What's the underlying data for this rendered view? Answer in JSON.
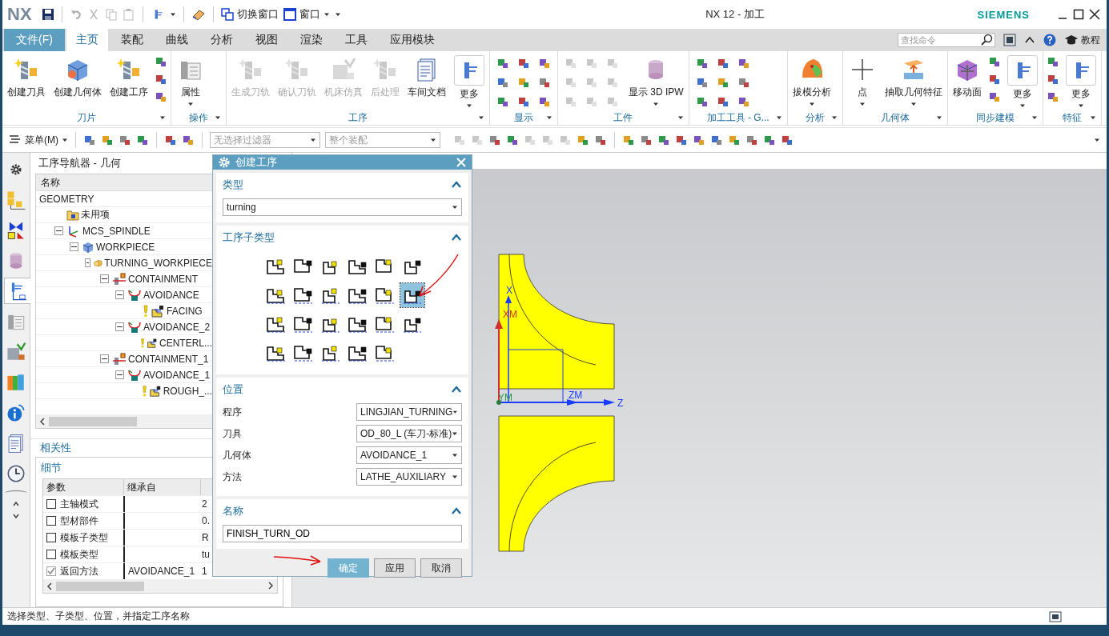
{
  "window": {
    "logo": "NX",
    "title": "NX 12 - 加工",
    "brand": "SIEMENS"
  },
  "quick_access": {
    "switch_window": "切换窗口",
    "window_menu": "窗口"
  },
  "file_tab": "文件(F)",
  "tabs": [
    {
      "label": "主页",
      "selected": true
    },
    {
      "label": "装配",
      "selected": false
    },
    {
      "label": "曲线",
      "selected": false
    },
    {
      "label": "分析",
      "selected": false
    },
    {
      "label": "视图",
      "selected": false
    },
    {
      "label": "渲染",
      "selected": false
    },
    {
      "label": "工具",
      "selected": false
    },
    {
      "label": "应用模块",
      "selected": false
    }
  ],
  "search": {
    "placeholder": "查找命令"
  },
  "help_label": "教程",
  "ribbon_groups": [
    {
      "label": "刀片",
      "items": [
        {
          "kind": "drill",
          "label": "创建刀具",
          "disabled": false,
          "dropdown": false
        },
        {
          "kind": "cube",
          "label": "创建几何体",
          "disabled": false,
          "dropdown": false
        },
        {
          "kind": "drill",
          "label": "创建工序",
          "disabled": false,
          "dropdown": false
        },
        {
          "kind": "small_column"
        }
      ]
    },
    {
      "label": "操作",
      "items": [
        {
          "kind": "table",
          "label": "属性",
          "disabled": false,
          "dropdown": true
        }
      ]
    },
    {
      "label": "工序",
      "items": [
        {
          "kind": "drill",
          "label": "生成刀轨",
          "disabled": true,
          "dropdown": false
        },
        {
          "kind": "drill",
          "label": "确认刀轨",
          "disabled": true,
          "dropdown": false
        },
        {
          "kind": "machine",
          "label": "机床仿真",
          "disabled": true,
          "dropdown": false
        },
        {
          "kind": "drill",
          "label": "后处理",
          "disabled": true,
          "dropdown": false
        },
        {
          "kind": "doc",
          "label": "车间文档",
          "disabled": false,
          "dropdown": false
        },
        {
          "kind": "more",
          "label": "更多",
          "disabled": false,
          "dropdown": true
        }
      ]
    },
    {
      "label": "显示",
      "items": [
        {
          "kind": "small_grid"
        }
      ]
    },
    {
      "label": "工件",
      "items": [
        {
          "kind": "small_grid"
        },
        {
          "kind": "cylinder",
          "label": "显示 3D IPW",
          "disabled": false,
          "dropdown": true
        }
      ]
    },
    {
      "label": "加工工具 - G...",
      "items": [
        {
          "kind": "small_grid"
        }
      ]
    },
    {
      "label": "分析",
      "items": [
        {
          "kind": "surface",
          "label": "拔模分析",
          "disabled": false,
          "dropdown": true
        }
      ]
    },
    {
      "label": "几何体",
      "items": [
        {
          "kind": "plus",
          "label": "点",
          "disabled": false,
          "dropdown": true
        },
        {
          "kind": "extract",
          "label": "抽取几何特征",
          "disabled": false,
          "dropdown": true
        }
      ]
    },
    {
      "label": "同步建模",
      "items": [
        {
          "kind": "move",
          "label": "移动面",
          "disabled": false,
          "dropdown": false
        },
        {
          "kind": "small_column"
        },
        {
          "kind": "more",
          "label": "更多",
          "disabled": false,
          "dropdown": true
        }
      ]
    },
    {
      "label": "特征",
      "items": [
        {
          "kind": "small_column"
        },
        {
          "kind": "more",
          "label": "更多",
          "disabled": false,
          "dropdown": true
        }
      ]
    }
  ],
  "toolbar": {
    "menu": "菜单(M)",
    "selection_filter": "无选择过滤器",
    "scope": "整个装配"
  },
  "resource_bar": [
    {
      "kind": "gear",
      "selected": false
    },
    {
      "kind": "blocks",
      "selected": false
    },
    {
      "kind": "constraint",
      "selected": false
    },
    {
      "kind": "cylinder",
      "selected": false
    },
    {
      "kind": "operation",
      "selected": true
    },
    {
      "kind": "table",
      "selected": false
    },
    {
      "kind": "machine",
      "selected": false
    },
    {
      "kind": "books",
      "selected": false
    },
    {
      "kind": "info",
      "selected": false
    },
    {
      "kind": "doc",
      "selected": false
    },
    {
      "kind": "clock",
      "selected": false
    }
  ],
  "navigator": {
    "title": "工序导航器 - 几何",
    "column": "名称",
    "tree": [
      {
        "kind": "root",
        "label": "GEOMETRY",
        "children": [
          {
            "kind": "folder",
            "label": "未用项"
          },
          {
            "kind": "mcs",
            "label": "MCS_SPINDLE",
            "expanded": true,
            "children": [
              {
                "kind": "workpiece",
                "label": "WORKPIECE",
                "expanded": true,
                "children": [
                  {
                    "kind": "turning_workpiece",
                    "label": "TURNING_WORKPIECE",
                    "expanded": true,
                    "children": [
                      {
                        "kind": "containment",
                        "label": "CONTAINMENT",
                        "expanded": true,
                        "children": [
                          {
                            "kind": "avoidance",
                            "label": "AVOIDANCE",
                            "expanded": true,
                            "children": [
                              {
                                "kind": "operation",
                                "label": "FACING"
                              }
                            ]
                          },
                          {
                            "kind": "avoidance",
                            "label": "AVOIDANCE_2",
                            "expanded": true,
                            "children": [
                              {
                                "kind": "operation",
                                "label": "CENTERL..."
                              }
                            ]
                          }
                        ]
                      },
                      {
                        "kind": "containment",
                        "label": "CONTAINMENT_1",
                        "expanded": true,
                        "children": [
                          {
                            "kind": "avoidance",
                            "label": "AVOIDANCE_1",
                            "expanded": true,
                            "children": [
                              {
                                "kind": "operation",
                                "label": "ROUGH_..."
                              }
                            ]
                          }
                        ]
                      }
                    ]
                  }
                ]
              }
            ]
          }
        ]
      }
    ]
  },
  "dependencies": {
    "title": "相关性"
  },
  "details": {
    "title": "细节",
    "columns": [
      "参数",
      "继承自"
    ],
    "rows": [
      {
        "checked": false,
        "param": "主轴模式",
        "inherited": "",
        "value": "2"
      },
      {
        "checked": false,
        "param": "型材部件",
        "inherited": "",
        "value": "0."
      },
      {
        "checked": false,
        "param": "模板子类型",
        "inherited": "",
        "value": "R"
      },
      {
        "checked": false,
        "param": "模板类型",
        "inherited": "",
        "value": "tu"
      },
      {
        "checked": true,
        "param": "返回方法",
        "inherited": "AVOIDANCE_1",
        "value": "1"
      }
    ]
  },
  "dialog": {
    "title": "创建工序",
    "type_section": {
      "title": "类型",
      "value": "turning"
    },
    "subtype_section": {
      "title": "工序子类型",
      "subtypes": [
        {
          "selected": false
        },
        {
          "selected": false
        },
        {
          "selected": false
        },
        {
          "selected": false
        },
        {
          "selected": false
        },
        {
          "selected": false
        },
        {
          "selected": false
        },
        {
          "selected": false
        },
        {
          "selected": false
        },
        {
          "selected": false
        },
        {
          "selected": false
        },
        {
          "selected": true
        },
        {
          "selected": false
        },
        {
          "selected": false
        },
        {
          "selected": false
        },
        {
          "selected": false
        },
        {
          "selected": false
        },
        {
          "selected": false
        },
        {
          "selected": false
        },
        {
          "selected": false
        },
        {
          "selected": false
        },
        {
          "selected": false
        },
        {
          "selected": false
        }
      ]
    },
    "location_section": {
      "title": "位置",
      "fields": [
        {
          "label": "程序",
          "value": "LINGJIAN_TURNING"
        },
        {
          "label": "刀具",
          "value": "OD_80_L (车刀-标准)"
        },
        {
          "label": "几何体",
          "value": "AVOIDANCE_1"
        },
        {
          "label": "方法",
          "value": "LATHE_AUXILIARY"
        }
      ]
    },
    "name_section": {
      "title": "名称",
      "value": "FINISH_TURN_OD"
    },
    "buttons": [
      {
        "label": "确定",
        "kind": "primary"
      },
      {
        "label": "应用",
        "kind": "normal"
      },
      {
        "label": "取消",
        "kind": "normal"
      }
    ]
  },
  "viewport": {
    "axis_labels": [
      {
        "kind": "x",
        "text": "X"
      },
      {
        "kind": "xm",
        "text": "XM"
      },
      {
        "kind": "ym",
        "text": "YM"
      },
      {
        "kind": "zm",
        "text": "ZM"
      },
      {
        "kind": "z",
        "text": "Z"
      }
    ]
  },
  "status_bar": "选择类型、子类型、位置，并指定工序名称"
}
